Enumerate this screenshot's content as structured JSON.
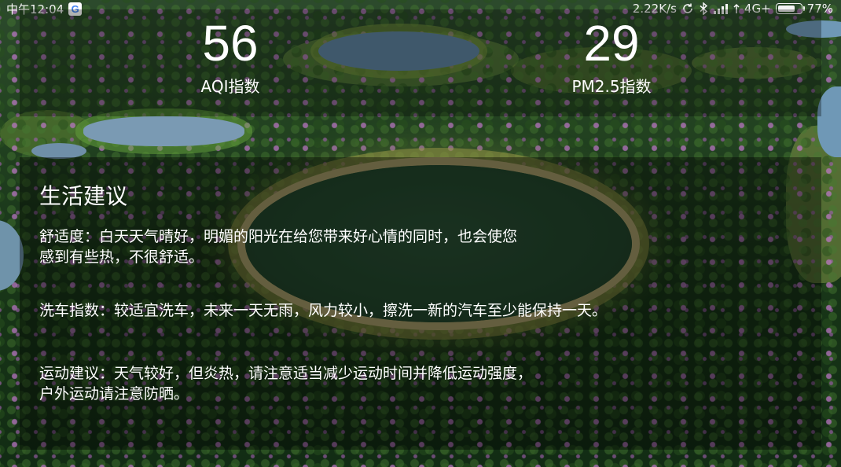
{
  "status_bar": {
    "time": "中午12:04",
    "google_icon": "G",
    "net_speed": "2.22K/s",
    "sync_icon": "sync-icon",
    "bluetooth_icon": "bluetooth-icon",
    "signal_icon": "signal-icon",
    "network_type": "4G+",
    "battery_percent": "77%",
    "battery_level": 0.77
  },
  "air": {
    "aqi_value": "56",
    "aqi_label": "AQI指数",
    "pm25_value": "29",
    "pm25_label": "PM2.5指数"
  },
  "advice": {
    "title": "生活建议",
    "items": [
      {
        "line1": "舒适度：白天天气晴好，明媚的阳光在给您带来好心情的同时，也会使您",
        "line2": "感到有些热，不很舒适。"
      },
      {
        "line1": "洗车指数：较适宜洗车，未来一天无雨，风力较小，擦洗一新的汽车至少能保持一天。",
        "line2": ""
      },
      {
        "line1": "运动建议：天气较好，但炎热，请注意适当减少运动时间并降低运动强度，",
        "line2": "户外运动请注意防晒。"
      }
    ]
  }
}
